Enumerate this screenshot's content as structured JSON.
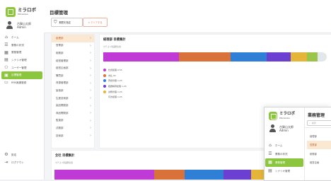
{
  "app": {
    "logo_text": "ミラロボ",
    "logo_sub": "Miralobo"
  },
  "user": {
    "name": "古賀山太郎",
    "role": "Admin"
  },
  "sidebar": {
    "items": [
      {
        "icon": "⌂",
        "label": "ホーム"
      },
      {
        "icon": "☰",
        "label": "業務の状況"
      },
      {
        "icon": "▦",
        "label": "業務管理"
      },
      {
        "icon": "▤",
        "label": "シナリオ管理"
      },
      {
        "icon": "⚇",
        "label": "ユーザー管理"
      },
      {
        "icon": "▣",
        "label": "目標管理"
      },
      {
        "icon": "▭",
        "label": "RPA実績登録"
      }
    ],
    "active_index": 5,
    "bottom": [
      {
        "icon": "⚙",
        "label": "設定"
      },
      {
        "icon": "⇥",
        "label": "ログアウト"
      }
    ]
  },
  "header": {
    "title": "目標管理",
    "filter_label": "期間を指定",
    "clear_label": "× クリアする"
  },
  "departments": [
    "経理部",
    "営業部",
    "総務部",
    "経営管理部",
    "経営企画部",
    "購買部",
    "資源管理部",
    "製造部",
    "生産技術部",
    "製品開発部",
    "商品開発部",
    "監査部",
    "法務部",
    "技術部"
  ],
  "selected_department": 0,
  "chart1": {
    "title": "経理部 目標集計",
    "subtitle": "カテゴリ別業務割合",
    "legend": [
      "仕訳処理 0.5h",
      "支払 0h",
      "売掛管理 1.2h",
      "経費精算処理 1.2h",
      "労務管理 1.2h",
      "月次処理 1.2h"
    ]
  },
  "chart2": {
    "title": "全社 目標集計",
    "subtitle": "カテゴリ別業務割合"
  },
  "colors": {
    "accent": "#8cc63f",
    "selected_bg": "#fbe8d3",
    "selected_text": "#c4632c"
  },
  "chart_data": [
    {
      "type": "bar",
      "orientation": "horizontal-stacked",
      "title": "経理部 目標集計",
      "subtitle": "カテゴリ別業務割合",
      "series": [
        {
          "name": "仕訳処理 0.5h",
          "value": 34,
          "color": "#c03bd6"
        },
        {
          "name": "支払 0h",
          "value": 23,
          "color": "#d9713a"
        },
        {
          "name": "売掛管理 1.2h",
          "value": 16,
          "color": "#2f7fd6"
        },
        {
          "name": "経費精算処理 1.2h",
          "value": 11,
          "color": "#6a3fd1"
        },
        {
          "name": "労務管理 1.2h",
          "value": 7,
          "color": "#e5b53a"
        },
        {
          "name": "月次処理 1.2h",
          "value": 5,
          "color": "#9bc44a"
        },
        {
          "name": "",
          "value": 4,
          "color": "#e3e6ea"
        }
      ]
    },
    {
      "type": "bar",
      "orientation": "horizontal-stacked",
      "title": "全社 目標集計",
      "subtitle": "カテゴリ別業務割合",
      "series": [
        {
          "value": 36,
          "color": "#c03bd6"
        },
        {
          "value": 11,
          "color": "#d9713a"
        },
        {
          "value": 14,
          "color": "#2f7fd6"
        },
        {
          "value": 10,
          "color": "#6a3fd1"
        },
        {
          "value": 6,
          "color": "#e5b53a"
        },
        {
          "value": 5,
          "color": "#9bc44a"
        },
        {
          "value": 18,
          "color": "#2f7fd6"
        }
      ]
    }
  ],
  "window2": {
    "title": "業務管理",
    "search_placeholder": "検索",
    "nav": [
      {
        "icon": "⌂",
        "label": "ホーム"
      },
      {
        "icon": "☰",
        "label": "業務の状況"
      },
      {
        "icon": "▦",
        "label": "業務管理"
      },
      {
        "icon": "▤",
        "label": "シナリオ管理"
      }
    ],
    "active_index": 2,
    "list": [
      "経理部",
      "営業部",
      "総務部",
      "経営企画"
    ],
    "selected_index": 1
  }
}
